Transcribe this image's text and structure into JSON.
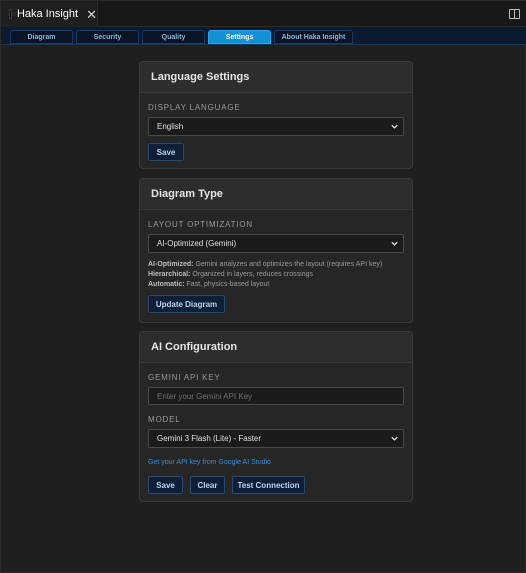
{
  "window": {
    "tab_title": "Haka Insight",
    "tab_icon": "app-icon",
    "close_icon": "close-icon",
    "split_icon": "split-editor-icon"
  },
  "nav": {
    "tabs": [
      {
        "label": "Diagram",
        "active": false
      },
      {
        "label": "Security",
        "active": false
      },
      {
        "label": "Quality",
        "active": false
      },
      {
        "label": "Settings",
        "active": true
      },
      {
        "label": "About Haka Insight",
        "active": false
      }
    ],
    "active_color": "#1390d6"
  },
  "language": {
    "title": "Language Settings",
    "field_label": "DISPLAY LANGUAGE",
    "selected": "English",
    "save_label": "Save"
  },
  "diagram": {
    "title": "Diagram Type",
    "field_label": "LAYOUT OPTIMIZATION",
    "selected": "AI-Optimized (Gemini)",
    "desc": [
      {
        "term": "AI-Optimized:",
        "text": " Gemini analyzes and optimizes the layout (requires API key)"
      },
      {
        "term": "Hierarchical:",
        "text": " Organized in layers, reduces crossings"
      },
      {
        "term": "Automatic:",
        "text": " Fast, physics-based layout"
      }
    ],
    "update_label": "Update Diagram"
  },
  "ai": {
    "title": "AI Configuration",
    "key_label": "GEMINI API KEY",
    "key_placeholder": "Enter your Gemini API Key",
    "model_label": "MODEL",
    "model_selected": "Gemini 3 Flash (Lite) - Faster",
    "link_text": "Get your API key from Google AI Studio",
    "save_label": "Save",
    "clear_label": "Clear",
    "test_label": "Test Connection"
  }
}
